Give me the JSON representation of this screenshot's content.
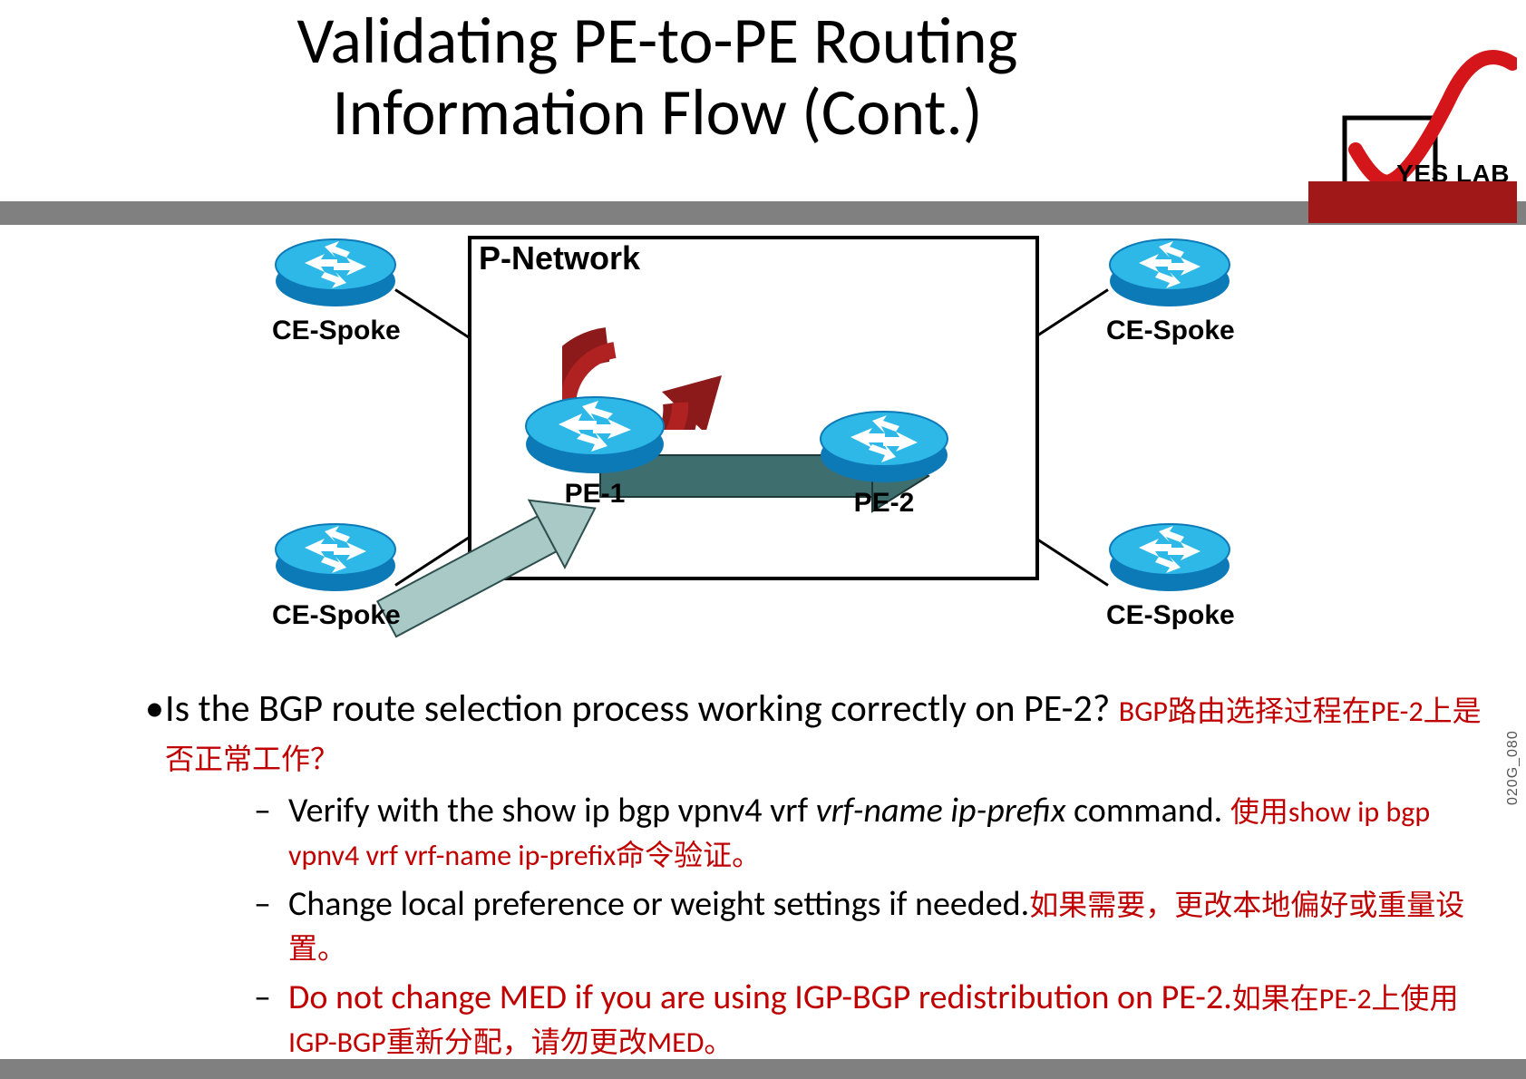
{
  "title_line1": "Validating PE-to-PE Routing",
  "title_line2": "Information Flow (Cont.)",
  "logo_text": "YES LAB",
  "diagram": {
    "pnetwork_label": "P-Network",
    "ce_spoke": "CE-Spoke",
    "pe1": "PE-1",
    "pe2": "PE-2",
    "side_code": "020G_080"
  },
  "bullet": {
    "q_en": "Is the BGP route selection process working correctly on PE-2?",
    "q_zh": "BGP路由选择过程在PE-2上是否正常工作？",
    "sub1_a": "Verify with the ",
    "sub1_b": "show ip bgp vpnv4 vrf ",
    "sub1_c": "vrf-name ip-prefix",
    "sub1_d": " command.",
    "sub1_zh": "使用show ip bgp vpnv4 vrf vrf-name ip-prefix命令验证。",
    "sub2_en": "Change local preference or weight settings if needed.",
    "sub2_zh": "如果需要，更改本地偏好或重量设置。",
    "sub3_en": "Do not change MED if you are using IGP-BGP redistribution on PE-2.",
    "sub3_zh": "如果在PE-2上使用IGP-BGP重新分配，请勿更改MED。"
  }
}
